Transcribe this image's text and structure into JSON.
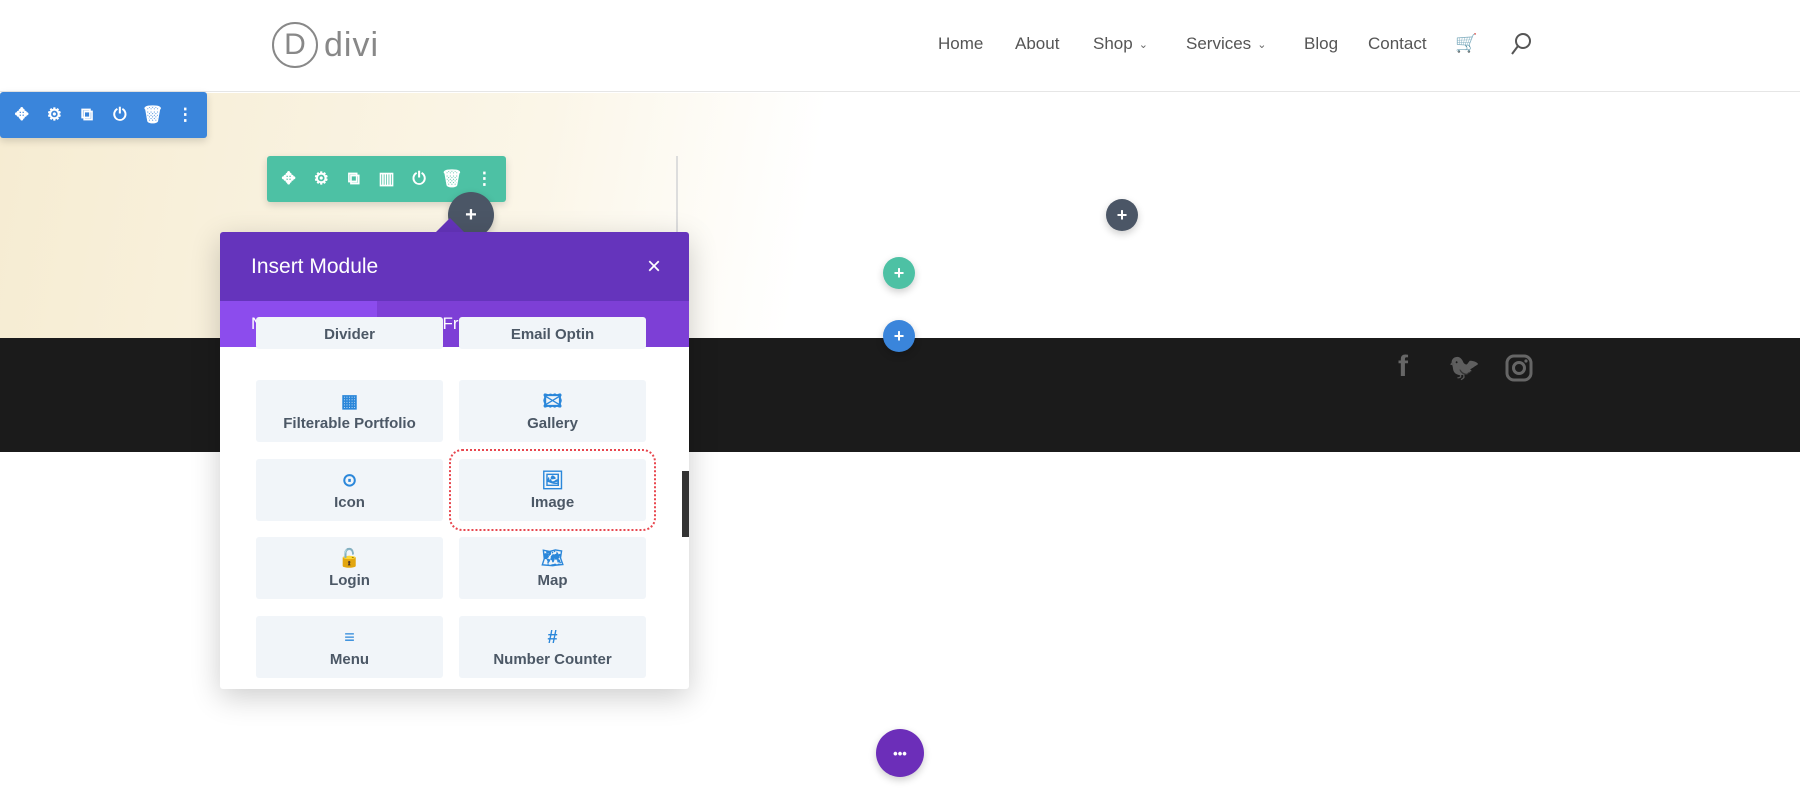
{
  "header": {
    "logo_letter": "D",
    "logo_text": "divi",
    "nav": [
      {
        "label": "Home"
      },
      {
        "label": "About"
      },
      {
        "label": "Shop",
        "dropdown": true
      },
      {
        "label": "Services",
        "dropdown": true
      },
      {
        "label": "Blog"
      },
      {
        "label": "Contact"
      }
    ],
    "cart_icon": "cart-icon",
    "search_icon": "search-icon"
  },
  "row_toolbar": {
    "color": "#3a85db",
    "icons": [
      "move",
      "settings",
      "duplicate",
      "power",
      "trash",
      "more"
    ]
  },
  "column_toolbar": {
    "color": "#4dc1a4",
    "icons": [
      "move",
      "settings",
      "duplicate",
      "columns",
      "power",
      "trash",
      "more"
    ]
  },
  "modal": {
    "title": "Insert Module",
    "close": "×",
    "header_color": "#6534bc",
    "tabs": [
      {
        "label": "New Module",
        "active": true
      },
      {
        "label": "Add From Library"
      }
    ],
    "partial_items": [
      "Divider",
      "Email Optin"
    ],
    "items": [
      {
        "label": "Filterable Portfolio",
        "icon": "▦"
      },
      {
        "label": "Gallery",
        "icon": "🖾"
      },
      {
        "label": "Icon",
        "icon": "⊙"
      },
      {
        "label": "Image",
        "icon": "🖼",
        "highlighted": true
      },
      {
        "label": "Login",
        "icon": "🔓"
      },
      {
        "label": "Map",
        "icon": "🗺"
      },
      {
        "label": "Menu",
        "icon": "≡"
      },
      {
        "label": "Number Counter",
        "icon": "#"
      }
    ]
  },
  "buttons": {
    "plus": "+",
    "more": "•••"
  },
  "footer": {
    "social": [
      "facebook",
      "twitter",
      "instagram"
    ],
    "fb": "f",
    "tw": "🐦",
    "ig": "◎"
  }
}
